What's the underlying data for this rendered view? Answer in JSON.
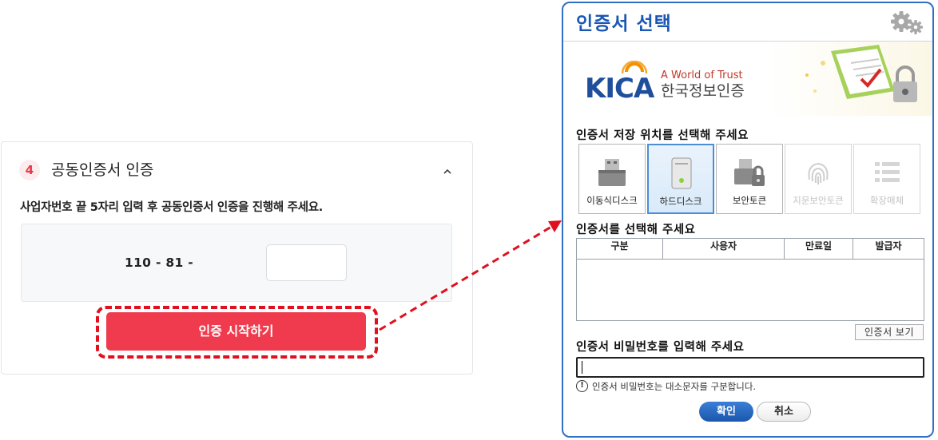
{
  "step": {
    "number": "4",
    "title": "공동인증서 인증",
    "description": "사업자번호 끝 5자리 입력 후 공동인증서 인증을 진행해 주세요.",
    "business_number_prefix": "110 - 81 -",
    "business_number_suffix_value": "",
    "start_button_label": "인증 시작하기",
    "accent_color": "#ef3b4d"
  },
  "dialog": {
    "title": "인증서 선택",
    "settings_icon": "gear-icon",
    "banner": {
      "brand": "KICA",
      "tagline": "A World of Trust",
      "org_name": "한국정보인증"
    },
    "storage_section_label": "인증서 저장 위치를 선택해 주세요",
    "storage_options": [
      {
        "label": "이동식디스크",
        "icon": "usb-drive-icon",
        "state": "enabled"
      },
      {
        "label": "하드디스크",
        "icon": "hard-disk-icon",
        "state": "selected"
      },
      {
        "label": "보안토큰",
        "icon": "security-token-icon",
        "state": "enabled"
      },
      {
        "label": "지문보안토큰",
        "icon": "fingerprint-icon",
        "state": "disabled"
      },
      {
        "label": "확장매체",
        "icon": "list-icon",
        "state": "disabled"
      }
    ],
    "cert_section_label": "인증서를 선택해 주세요",
    "cert_columns": [
      "구분",
      "사용자",
      "만료일",
      "발급자"
    ],
    "view_cert_button_label": "인증서 보기",
    "password_section_label": "인증서 비밀번호를 입력해 주세요",
    "password_value": "",
    "password_hint": "인증서 비밀번호는 대소문자를 구분합니다.",
    "ok_button_label": "확인",
    "cancel_button_label": "취소",
    "border_color": "#2f6fc6"
  }
}
